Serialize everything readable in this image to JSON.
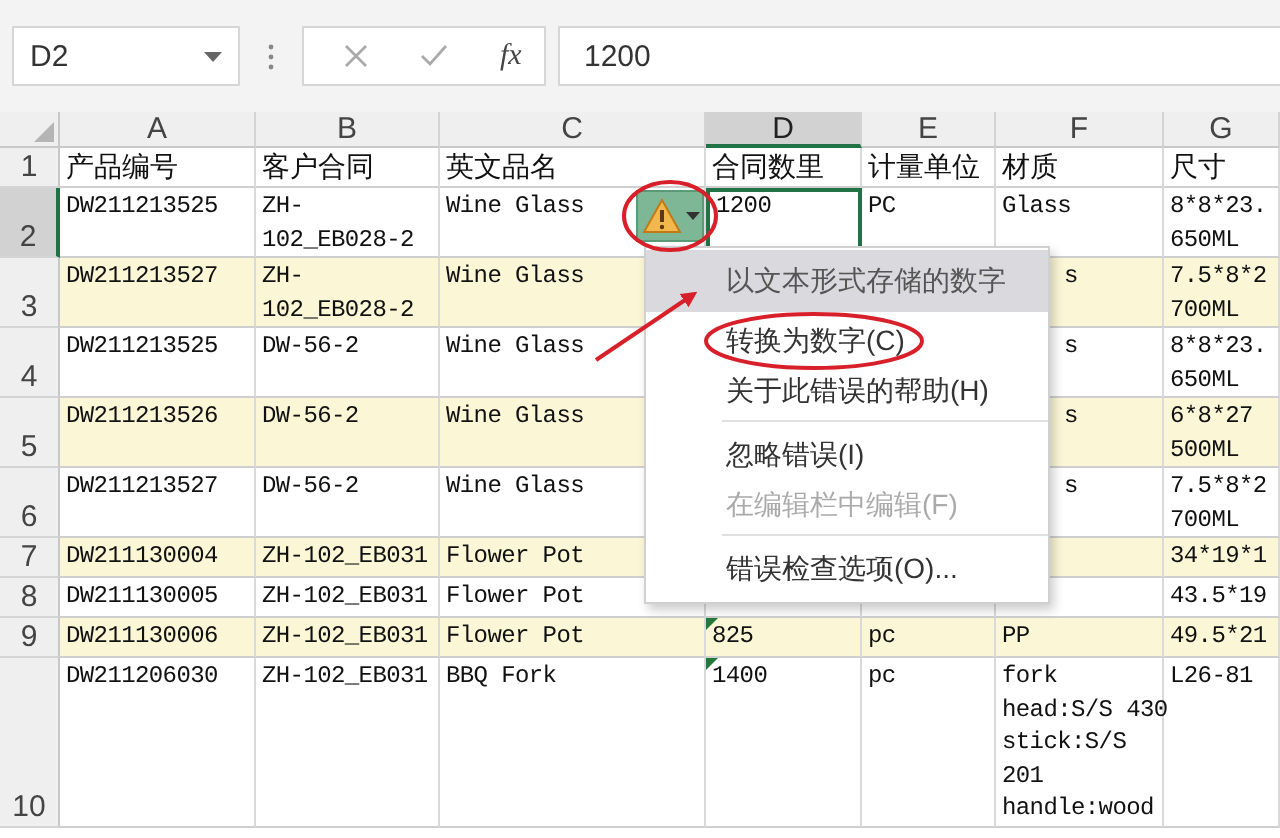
{
  "name_box": "D2",
  "formula_bar": {
    "function_label": "fx",
    "value": "1200"
  },
  "columns": [
    {
      "label": "A",
      "selected": false
    },
    {
      "label": "B",
      "selected": false
    },
    {
      "label": "C",
      "selected": false
    },
    {
      "label": "D",
      "selected": true
    },
    {
      "label": "E",
      "selected": false
    },
    {
      "label": "F",
      "selected": false
    },
    {
      "label": "G",
      "selected": false
    }
  ],
  "rows": [
    {
      "number": "1",
      "selected": false,
      "band": false,
      "kind": "header",
      "error_flag": false,
      "cells": [
        "产品编号",
        "客户合同",
        "英文品名",
        "合同数里",
        "计量单位",
        "材质",
        "尺寸"
      ]
    },
    {
      "number": "2",
      "selected": true,
      "band": false,
      "kind": "data",
      "error_flag": false,
      "cells": [
        "DW211213525",
        "ZH-\n102_EB028-2",
        "Wine Glass",
        "1200",
        "PC",
        "Glass",
        "8*8*23.\n650ML"
      ]
    },
    {
      "number": "3",
      "selected": false,
      "band": true,
      "kind": "data",
      "error_flag": false,
      "cells": [
        "DW211213527",
        "ZH-\n102_EB028-2",
        "Wine Glass",
        null,
        null,
        {
          "text": "s",
          "covered": true
        },
        "7.5*8*2\n700ML"
      ]
    },
    {
      "number": "4",
      "selected": false,
      "band": false,
      "kind": "data",
      "error_flag": false,
      "cells": [
        "DW211213525",
        "DW-56-2",
        "Wine Glass",
        null,
        null,
        {
          "text": "s",
          "covered": true
        },
        "8*8*23.\n650ML"
      ]
    },
    {
      "number": "5",
      "selected": false,
      "band": true,
      "kind": "data",
      "error_flag": false,
      "cells": [
        "DW211213526",
        "DW-56-2",
        "Wine Glass",
        null,
        null,
        {
          "text": "s",
          "covered": true
        },
        "6*8*27\n500ML"
      ]
    },
    {
      "number": "6",
      "selected": false,
      "band": false,
      "kind": "data",
      "error_flag": false,
      "cells": [
        "DW211213527",
        "DW-56-2",
        "Wine Glass",
        null,
        null,
        {
          "text": "s",
          "covered": true
        },
        "7.5*8*2\n700ML"
      ]
    },
    {
      "number": "7",
      "selected": false,
      "band": true,
      "kind": "data",
      "error_flag": false,
      "cells": [
        "DW211130004",
        "ZH-102_EB031",
        "Flower Pot",
        null,
        null,
        null,
        "34*19*1"
      ]
    },
    {
      "number": "8",
      "selected": false,
      "band": false,
      "kind": "data",
      "error_flag": false,
      "cells": [
        "DW211130005",
        "ZH-102_EB031",
        "Flower Pot",
        null,
        null,
        null,
        "43.5*19"
      ]
    },
    {
      "number": "9",
      "selected": false,
      "band": true,
      "kind": "data",
      "error_flag": true,
      "cells": [
        "DW211130006",
        "ZH-102_EB031",
        "Flower Pot",
        "825",
        "pc",
        "PP",
        "49.5*21"
      ]
    },
    {
      "number": "10",
      "selected": false,
      "band": false,
      "kind": "data",
      "error_flag": true,
      "cells": [
        "DW211206030",
        "ZH-102_EB031",
        "BBQ Fork",
        "1400",
        "pc",
        "fork\nhead:S/S 430\nstick:S/S\n201\nhandle:wood",
        "L26-81"
      ]
    }
  ],
  "error_button": {
    "expanded": true,
    "circled": true
  },
  "error_menu": [
    {
      "kind": "title",
      "label": "以文本形式存储的数字",
      "separator_before": false,
      "circled": false,
      "pointed_at": true
    },
    {
      "kind": "item",
      "label": "转换为数字(C)",
      "separator_before": false,
      "circled": true,
      "pointed_at": false
    },
    {
      "kind": "item",
      "label": "关于此错误的帮助(H)",
      "separator_before": false,
      "circled": false,
      "pointed_at": false
    },
    {
      "kind": "item",
      "label": "忽略错误(I)",
      "separator_before": true,
      "circled": false,
      "pointed_at": false
    },
    {
      "kind": "disabled",
      "label": "在编辑栏中编辑(F)",
      "separator_before": false,
      "circled": false,
      "pointed_at": false
    },
    {
      "kind": "item",
      "label": "错误检查选项(O)...",
      "separator_before": true,
      "circled": false,
      "pointed_at": false
    }
  ]
}
